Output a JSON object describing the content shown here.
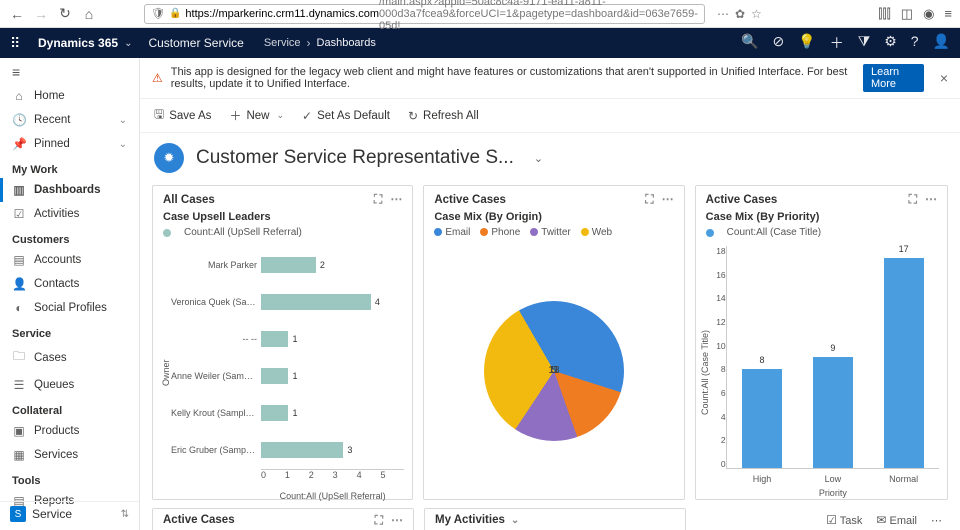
{
  "browser": {
    "url_host": "https://mparkerinc.crm11.dynamics.com",
    "url_path": "/main.aspx?appid=50ac8c4a-9171-ea11-a811-000d3a7fcea9&forceUCI=1&pagetype=dashboard&id=063e7659-05d!"
  },
  "appbar": {
    "brand": "Dynamics 365",
    "area": "Customer Service",
    "crumb1": "Service",
    "crumb2": "Dashboards"
  },
  "rail": {
    "home": "Home",
    "recent": "Recent",
    "pinned": "Pinned",
    "g_mywork": "My Work",
    "dashboards": "Dashboards",
    "activities": "Activities",
    "g_customers": "Customers",
    "accounts": "Accounts",
    "contacts": "Contacts",
    "social": "Social Profiles",
    "g_service": "Service",
    "cases": "Cases",
    "queues": "Queues",
    "g_collateral": "Collateral",
    "products": "Products",
    "services": "Services",
    "g_tools": "Tools",
    "reports": "Reports",
    "bottom_label": "Service"
  },
  "banner": {
    "text": "This app is designed for the legacy web client and might have features or customizations that aren't supported in Unified Interface. For best results, update it to Unified Interface.",
    "learn": "Learn More"
  },
  "cmd": {
    "saveas": "Save As",
    "new": "New",
    "setdefault": "Set As Default",
    "refresh": "Refresh All"
  },
  "title": "Customer Service Representative S...",
  "card1": {
    "title": "All Cases",
    "subtitle": "Case Upsell Leaders",
    "legend": "Count:All (UpSell Referral)"
  },
  "card2": {
    "title": "Active Cases",
    "subtitle": "Case Mix (By Origin)",
    "l1": "Email",
    "l2": "Phone",
    "l3": "Twitter",
    "l4": "Web"
  },
  "card3": {
    "title": "Active Cases",
    "subtitle": "Case Mix (By Priority)",
    "legend": "Count:All (Case Title)"
  },
  "card4": {
    "title": "Active Cases"
  },
  "card5": {
    "title": "My Activities"
  },
  "footer": {
    "task": "Task",
    "email": "Email"
  },
  "chart_data": [
    {
      "type": "bar",
      "orientation": "horizontal",
      "title": "Case Upsell Leaders",
      "ylabel": "Owner",
      "xlabel": "Count:All (UpSell Referral)",
      "xlim": [
        0,
        5
      ],
      "categories": [
        "Mark Parker",
        "Veronica Quek (Sampl...",
        "-- --",
        "Anne Weiler (Sample ...",
        "Kelly Krout (Sample D...",
        "Eric Gruber (Sample D..."
      ],
      "values": [
        2,
        4,
        1,
        1,
        1,
        3
      ]
    },
    {
      "type": "pie",
      "title": "Case Mix (By Origin)",
      "series": [
        {
          "name": "Email",
          "value": 13,
          "color": "#3a86d8"
        },
        {
          "name": "Phone",
          "value": 5,
          "color": "#f07c22"
        },
        {
          "name": "Twitter",
          "value": 5,
          "color": "#8e6fc1"
        },
        {
          "name": "Web",
          "value": 11,
          "color": "#f2b90f"
        }
      ]
    },
    {
      "type": "bar",
      "orientation": "vertical",
      "title": "Case Mix (By Priority)",
      "ylabel": "Count:All (Case Title)",
      "xlabel": "Priority",
      "ylim": [
        0,
        18
      ],
      "categories": [
        "High",
        "Low",
        "Normal"
      ],
      "values": [
        8,
        9,
        17
      ]
    }
  ]
}
